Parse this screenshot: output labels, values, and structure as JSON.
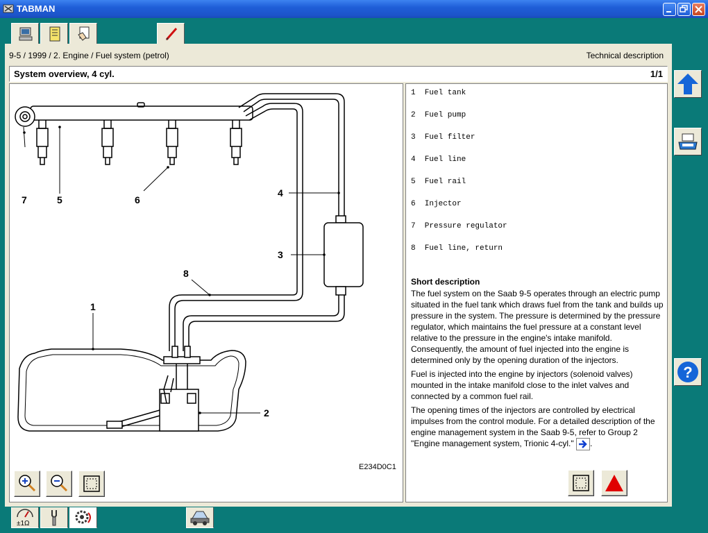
{
  "window": {
    "title": "TABMAN"
  },
  "top_tabs": [
    {
      "name": "computer-icon"
    },
    {
      "name": "notebook-icon"
    },
    {
      "name": "hand-document-icon"
    },
    {
      "name": "pencil-icon"
    }
  ],
  "breadcrumb": "9-5 / 1999 / 2. Engine / Fuel system (petrol)",
  "doc_type": "Technical description",
  "page_header": {
    "title": "System overview, 4 cyl.",
    "page": "1/1"
  },
  "figure": {
    "code": "E234D0C1",
    "callouts": [
      "1",
      "2",
      "3",
      "4",
      "5",
      "6",
      "7",
      "8"
    ]
  },
  "legend": [
    "1  Fuel tank",
    "2  Fuel pump",
    "3  Fuel filter",
    "4  Fuel line",
    "5  Fuel rail",
    "6  Injector",
    "7  Pressure regulator",
    "8  Fuel line, return"
  ],
  "short_description": {
    "title": "Short description",
    "p1": "The fuel system on the Saab 9-5 operates through an electric pump situated in the fuel tank which draws fuel from the tank and builds up pressure in the system. The pressure is determined by the pressure regulator, which maintains the fuel pressure at a constant level relative to the pressure in the engine's intake manifold. Consequently, the amount of fuel injected into the engine is determined only by the opening duration of the injectors.",
    "p2": "Fuel is injected into the engine by injectors (solenoid valves) mounted in the intake manifold close to the inlet valves and connected by a common fuel rail.",
    "p3": "The opening times of the injectors are controlled by electrical impulses from the control module. For a detailed description of the engine management system in the Saab 9-5, refer to Group 2 \"Engine management system, Trionic 4-cyl.\"",
    "p3_end": "."
  },
  "zoom_controls": [
    "zoom-in-icon",
    "zoom-out-icon",
    "fit-icon"
  ],
  "right_toolbar": [
    "up-arrow-icon",
    "printer-icon",
    "help-icon"
  ],
  "bottom_tabs": [
    {
      "name": "meter-icon"
    },
    {
      "name": "wrench-icon"
    },
    {
      "name": "gear-circuit-icon"
    },
    {
      "name": "car-tool-icon"
    }
  ],
  "colors": {
    "teal": "#0a7a78",
    "titlebar": "#1f5ed8",
    "panel": "#ece9d8",
    "up_arrow": "#1565d8",
    "warning": "#e00000"
  }
}
